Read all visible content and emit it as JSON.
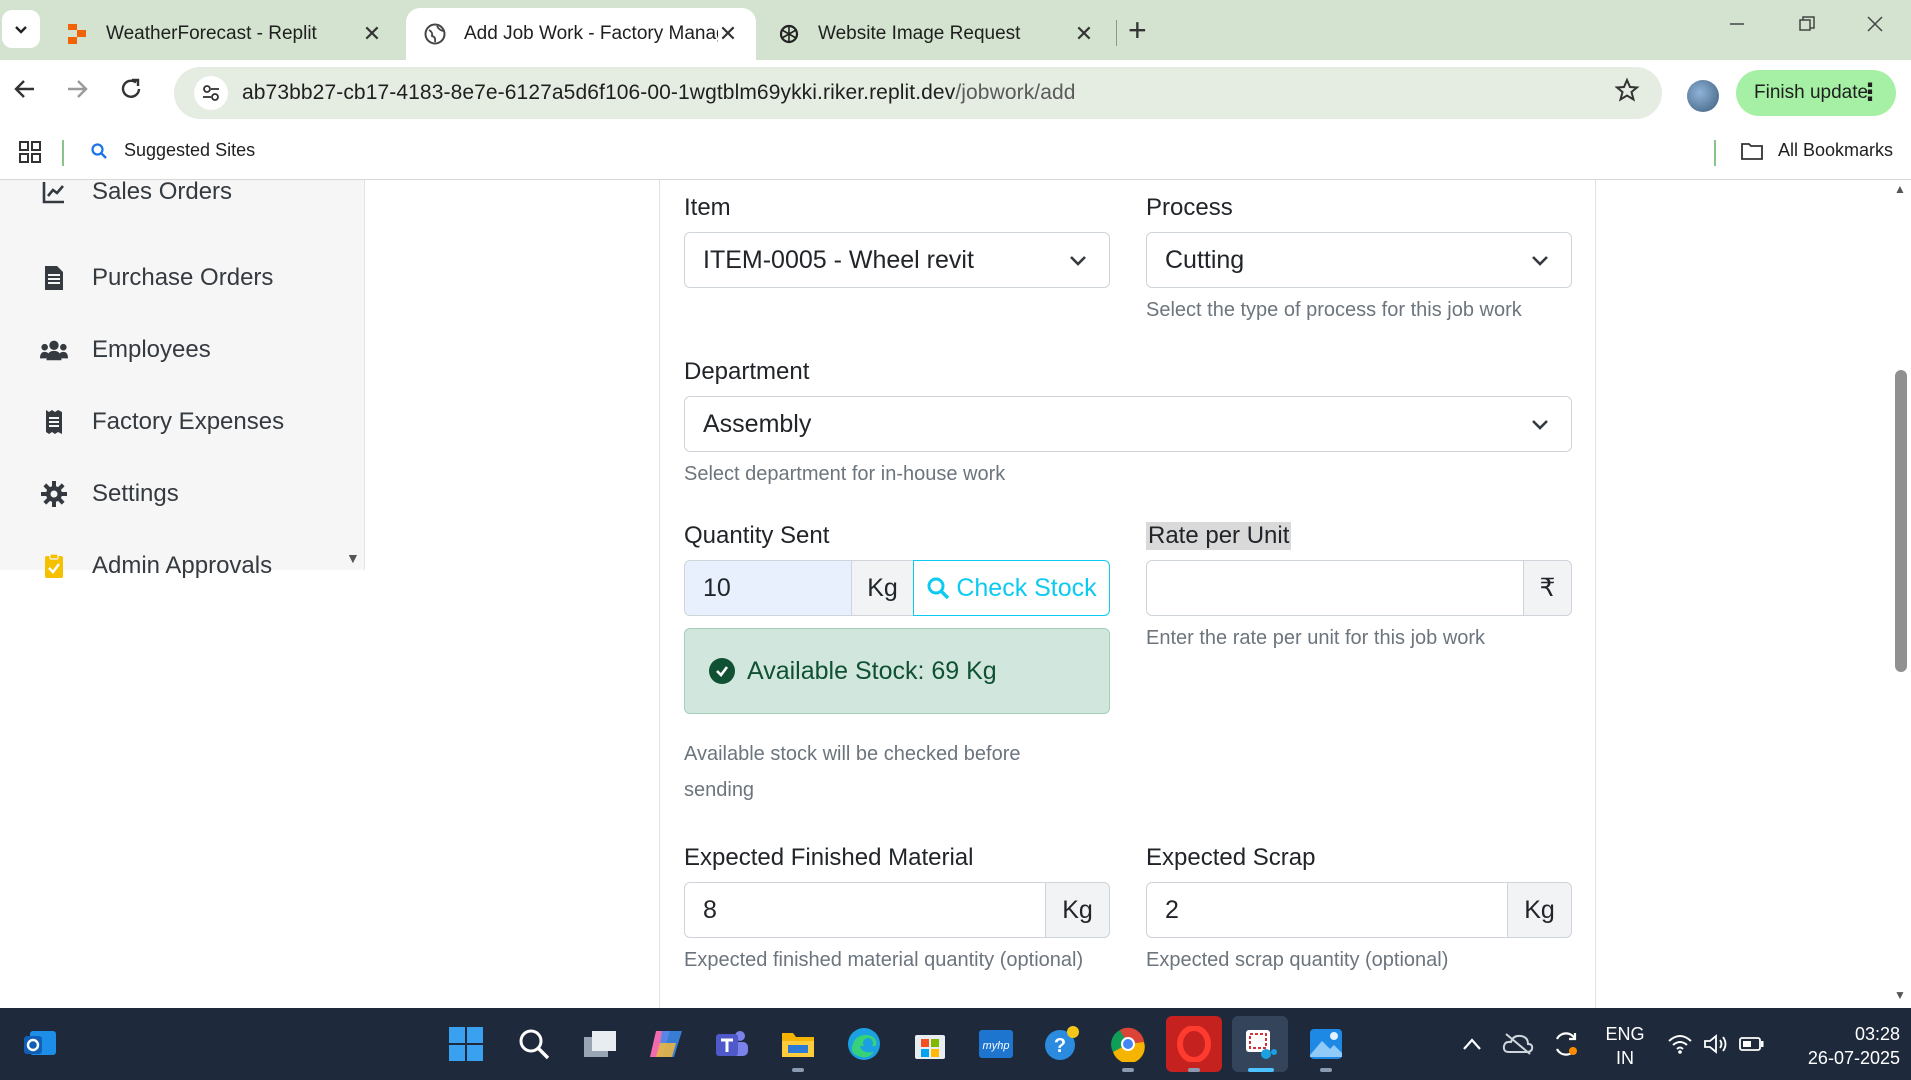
{
  "browser": {
    "tabs": [
      {
        "title": "WeatherForecast - Replit",
        "active": false
      },
      {
        "title": "Add Job Work - Factory Manage",
        "active": true
      },
      {
        "title": "Website Image Request",
        "active": false
      }
    ],
    "url_host": "ab73bb27-cb17-4183-8e7e-6127a5d6f106-00-1wgtblm69ykki.riker.replit.dev",
    "url_path": "/jobwork/add",
    "finish_update": "Finish update",
    "bookmarks": {
      "suggested": "Suggested Sites",
      "all": "All Bookmarks"
    }
  },
  "sidebar": {
    "items": [
      {
        "label": "Sales Orders",
        "icon": "chart-line-icon"
      },
      {
        "label": "Purchase Orders",
        "icon": "file-invoice-icon"
      },
      {
        "label": "Employees",
        "icon": "users-icon"
      },
      {
        "label": "Factory Expenses",
        "icon": "receipt-icon"
      },
      {
        "label": "Settings",
        "icon": "gear-icon"
      },
      {
        "label": "Admin Approvals",
        "icon": "clipboard-check-icon"
      }
    ]
  },
  "form": {
    "item": {
      "label": "Item",
      "value": "ITEM-0005 - Wheel revit"
    },
    "process": {
      "label": "Process",
      "value": "Cutting",
      "help": "Select the type of process for this job work"
    },
    "department": {
      "label": "Department",
      "value": "Assembly",
      "help": "Select department for in-house work"
    },
    "quantity_sent": {
      "label": "Quantity Sent",
      "value": "10",
      "unit": "Kg",
      "check_button": "Check Stock",
      "stock_alert": "Available Stock: 69 Kg",
      "help_line1": "Available stock will be checked before",
      "help_line2": "sending"
    },
    "rate_per_unit": {
      "label": "Rate per Unit",
      "value": "",
      "currency": "₹",
      "help": "Enter the rate per unit for this job work"
    },
    "expected_finished": {
      "label": "Expected Finished Material",
      "value": "8",
      "unit": "Kg",
      "help": "Expected finished material quantity (optional)"
    },
    "expected_scrap": {
      "label": "Expected Scrap",
      "value": "2",
      "unit": "Kg",
      "help": "Expected scrap quantity (optional)"
    }
  },
  "taskbar": {
    "lang_line1": "ENG",
    "lang_line2": "IN",
    "time": "03:28",
    "date": "26-07-2025"
  },
  "colors": {
    "accent_info": "#0dcaf0",
    "success_bg": "#d1e7dd",
    "chrome_green": "#d3e3cf",
    "taskbar": "#1e2a3b"
  }
}
